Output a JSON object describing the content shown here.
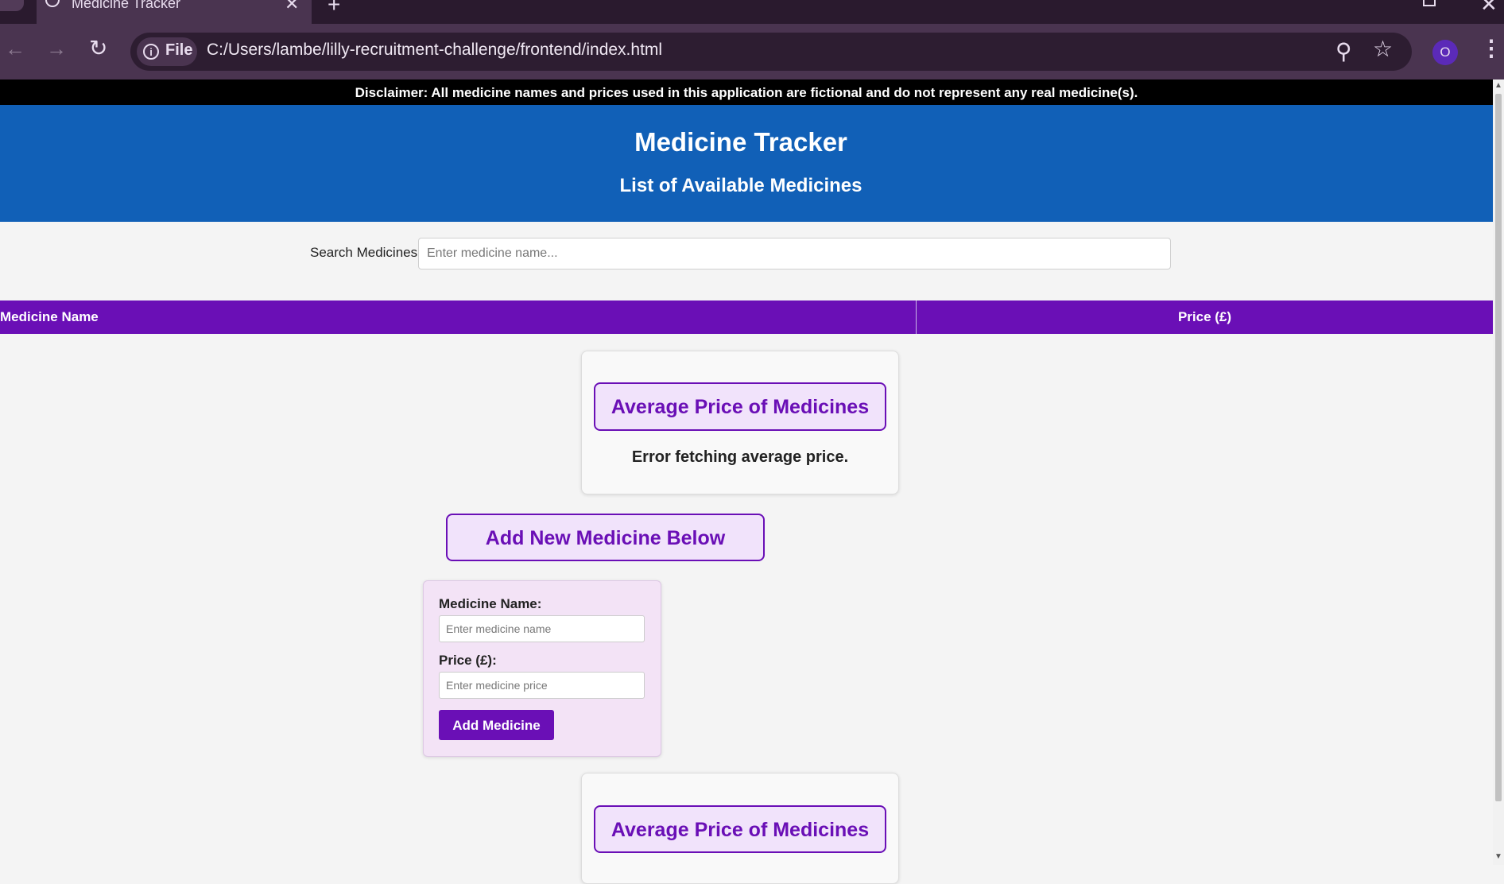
{
  "browser": {
    "tab_title": "Medicine Tracker",
    "tab_close": "✕",
    "new_tab": "+",
    "file_label": "File",
    "info_icon": "i",
    "url": "C:/Users/lambe/lilly-recruitment-challenge/frontend/index.html",
    "avatar_letter": "O",
    "icons": {
      "back": "arrow-left-icon",
      "forward": "arrow-right-icon",
      "reload": "reload-icon",
      "zoom": "zoom-icon",
      "bookmark": "star-icon",
      "menu": "kebab-menu-icon"
    }
  },
  "page": {
    "disclaimer": "Disclaimer: All medicine names and prices used in this application are fictional and do not represent any real medicine(s).",
    "title": "Medicine Tracker",
    "subtitle": "List of Available Medicines",
    "search": {
      "label": "Search Medicines:",
      "placeholder": "Enter medicine name..."
    },
    "table": {
      "columns": [
        "Medicine Name",
        "Price (£)"
      ]
    },
    "average": {
      "button_label": "Average Price of Medicines",
      "error": "Error fetching average price."
    },
    "add_new_label": "Add New Medicine Below",
    "form": {
      "name_label": "Medicine Name:",
      "name_placeholder": "Enter medicine name",
      "price_label": "Price (£):",
      "price_placeholder": "Enter medicine price",
      "submit_label": "Add Medicine"
    }
  },
  "colors": {
    "header_blue": "#1160b7",
    "accent_purple": "#6a0fb6",
    "browser_frame": "#4a3450",
    "disclaimer_bg": "#000000"
  }
}
